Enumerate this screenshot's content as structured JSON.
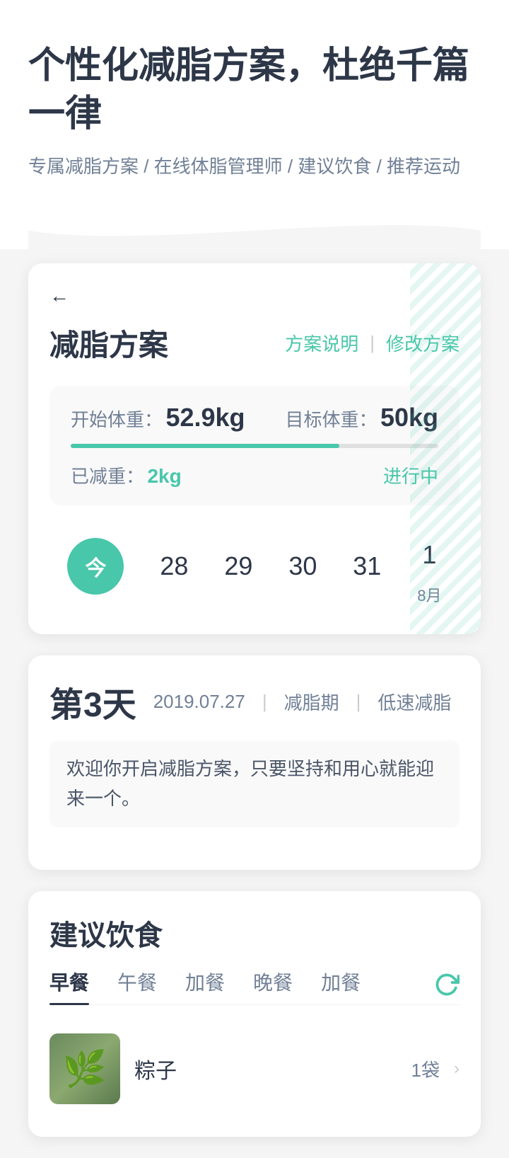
{
  "header": {
    "main_title": "个性化减脂方案，杜绝千篇一律",
    "sub_title": "专属减脂方案 / 在线体脂管理师 / 建议饮食 / 推荐运动"
  },
  "plan_card": {
    "back_icon": "←",
    "title": "减脂方案",
    "action_explain": "方案说明",
    "action_divider": "|",
    "action_modify": "修改方案",
    "start_weight_label": "开始体重：",
    "start_weight_value": "52.9kg",
    "target_weight_label": "目标体重：",
    "target_weight_value": "50kg",
    "progress_percent": 73,
    "loss_label": "已减重：",
    "loss_value": "2kg",
    "status": "进行中"
  },
  "date_picker": {
    "today_label": "今",
    "dates": [
      "28",
      "29",
      "30",
      "31"
    ],
    "last_date_num": "1",
    "last_date_month": "8月"
  },
  "day_info": {
    "day_label": "第3天",
    "date": "2019.07.27",
    "separator1": "|",
    "tag1": "减脂期",
    "separator2": "|",
    "tag2": "低速减脂",
    "message": "欢迎你开启减脂方案，只要坚持和用心就能迎来一个。"
  },
  "diet_section": {
    "title": "建议饮食",
    "tabs": [
      {
        "label": "早餐",
        "active": true
      },
      {
        "label": "午餐",
        "active": false
      },
      {
        "label": "加餐",
        "active": false
      },
      {
        "label": "晚餐",
        "active": false
      },
      {
        "label": "加餐",
        "active": false
      }
    ],
    "refresh_icon": "↺",
    "food_items": [
      {
        "name": "粽子",
        "quantity": "1袋",
        "thumb_emoji": "🌿"
      }
    ]
  }
}
